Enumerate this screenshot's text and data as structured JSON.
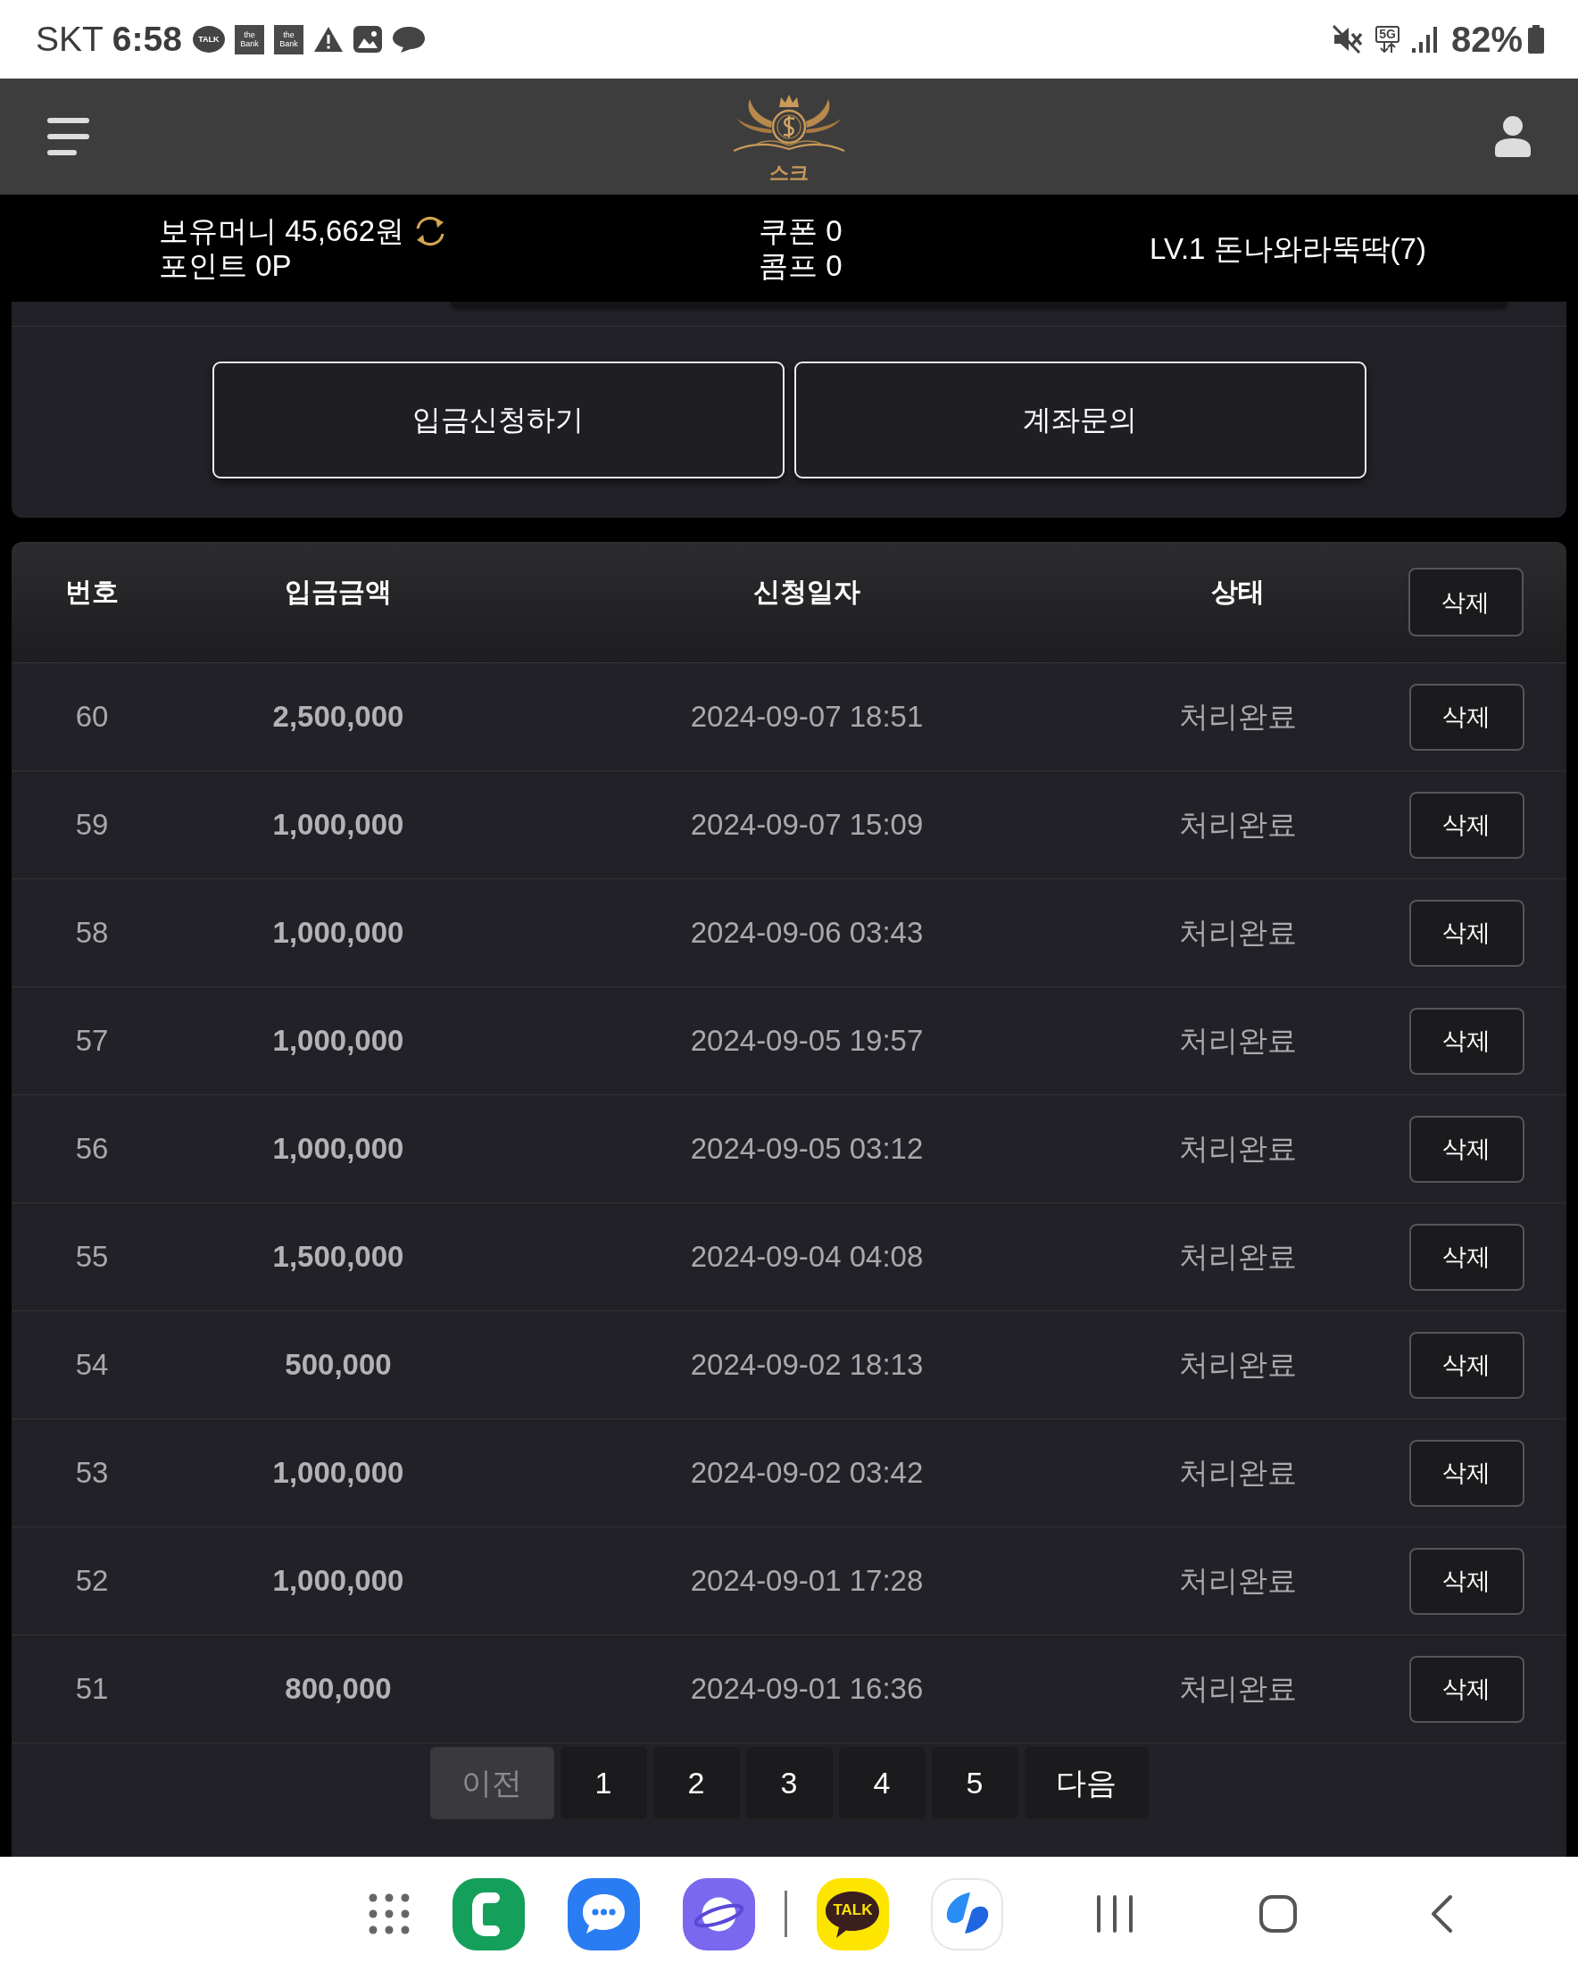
{
  "status_bar": {
    "carrier": "SKT",
    "time": "6:58",
    "notifications": [
      {
        "kind": "talk",
        "label": "TALK"
      },
      {
        "kind": "bank",
        "label": "the Bank"
      },
      {
        "kind": "bank",
        "label": "the Bank"
      },
      {
        "kind": "warning"
      },
      {
        "kind": "image"
      },
      {
        "kind": "chat"
      }
    ],
    "network": "5G",
    "battery": "82%"
  },
  "header": {
    "logo_text": "스크"
  },
  "account": {
    "money": "보유머니 45,662원",
    "points": "포인트 0P",
    "coupons": "쿠폰 0",
    "comp": "콤프 0",
    "level": "LV.1 돈나와라뚝딱(7)"
  },
  "actions": [
    "입금신청하기",
    "계좌문의"
  ],
  "table": {
    "columns": [
      "번호",
      "입금금액",
      "신청일자",
      "상태"
    ],
    "header_button": "삭제",
    "rows": [
      {
        "no": "60",
        "amount": "2,500,000",
        "date": "2024-09-07 18:51",
        "status": "처리완료",
        "action": "삭제"
      },
      {
        "no": "59",
        "amount": "1,000,000",
        "date": "2024-09-07 15:09",
        "status": "처리완료",
        "action": "삭제"
      },
      {
        "no": "58",
        "amount": "1,000,000",
        "date": "2024-09-06 03:43",
        "status": "처리완료",
        "action": "삭제"
      },
      {
        "no": "57",
        "amount": "1,000,000",
        "date": "2024-09-05 19:57",
        "status": "처리완료",
        "action": "삭제"
      },
      {
        "no": "56",
        "amount": "1,000,000",
        "date": "2024-09-05 03:12",
        "status": "처리완료",
        "action": "삭제"
      },
      {
        "no": "55",
        "amount": "1,500,000",
        "date": "2024-09-04 04:08",
        "status": "처리완료",
        "action": "삭제"
      },
      {
        "no": "54",
        "amount": "500,000",
        "date": "2024-09-02 18:13",
        "status": "처리완료",
        "action": "삭제"
      },
      {
        "no": "53",
        "amount": "1,000,000",
        "date": "2024-09-02 03:42",
        "status": "처리완료",
        "action": "삭제"
      },
      {
        "no": "52",
        "amount": "1,000,000",
        "date": "2024-09-01 17:28",
        "status": "처리완료",
        "action": "삭제"
      },
      {
        "no": "51",
        "amount": "800,000",
        "date": "2024-09-01 16:36",
        "status": "처리완료",
        "action": "삭제"
      }
    ]
  },
  "pagination": [
    {
      "kind": "prev",
      "label": "이전",
      "disabled": true
    },
    {
      "kind": "page",
      "label": "1",
      "disabled": false
    },
    {
      "kind": "page",
      "label": "2",
      "disabled": false
    },
    {
      "kind": "page",
      "label": "3",
      "disabled": false
    },
    {
      "kind": "page",
      "label": "4",
      "disabled": false
    },
    {
      "kind": "page",
      "label": "5",
      "disabled": false
    },
    {
      "kind": "next",
      "label": "다음",
      "disabled": false
    }
  ],
  "dock": [
    {
      "kind": "apps"
    },
    {
      "kind": "phone"
    },
    {
      "kind": "messages"
    },
    {
      "kind": "browser"
    },
    {
      "kind": "divider"
    },
    {
      "kind": "talk",
      "label": "TALK"
    },
    {
      "kind": "swirl"
    },
    {
      "kind": "recent"
    },
    {
      "kind": "home"
    },
    {
      "kind": "back"
    }
  ]
}
